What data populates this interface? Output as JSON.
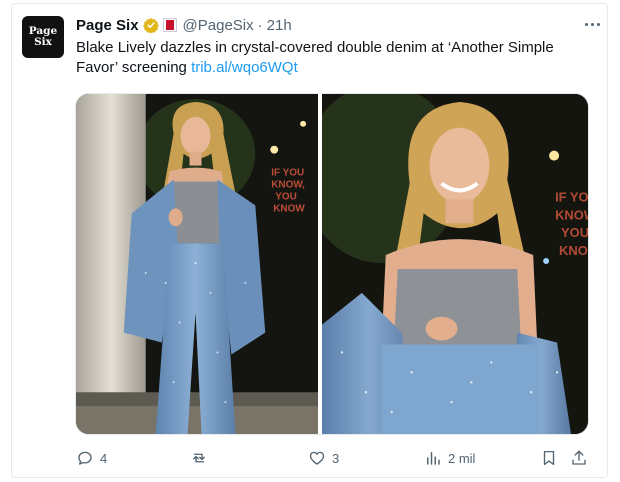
{
  "tweet": {
    "author": {
      "display_name": "Page Six",
      "avatar_text_line1": "Page",
      "avatar_text_line2": "Six",
      "handle": "@PageSix",
      "separator": "·",
      "time": "21h",
      "verified_icon": "gold-verified-badge",
      "affiliation_icon": "affiliate-badge-icon"
    },
    "text_prefix": "Blake Lively dazzles in crystal-covered double denim at ‘Another Simple Favor’ screening ",
    "link": "trib.al/wqo6WQt",
    "media": [
      {
        "type": "photo",
        "description": "full-length"
      },
      {
        "type": "photo",
        "description": "close-up"
      }
    ],
    "background_sign_left": [
      "IF YOU",
      "KNOW,",
      "YOU",
      "KNOW"
    ],
    "background_sign_right": [
      "IF YOU",
      "KNOW",
      "YOU",
      "KNOW"
    ],
    "actions": {
      "reply_count": "4",
      "retweet_count": "",
      "like_count": "3",
      "views_count": "2 mil"
    }
  },
  "colors": {
    "link": "#1d9bf0",
    "muted": "#536471",
    "verified_gold": "#e2b719",
    "denim": "#7fa6cf"
  }
}
